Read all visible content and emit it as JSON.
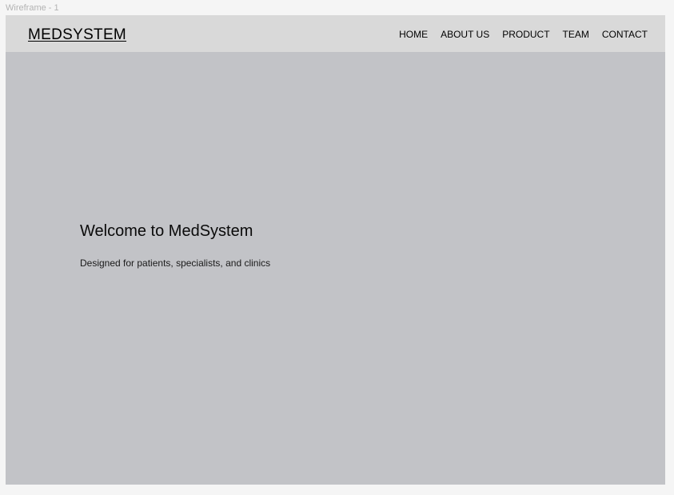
{
  "canvas": {
    "frame_label": "Wireframe - 1"
  },
  "header": {
    "logo": "MEDSYSTEM",
    "nav": [
      {
        "label": "HOME"
      },
      {
        "label": "ABOUT US"
      },
      {
        "label": "PRODUCT"
      },
      {
        "label": "TEAM"
      },
      {
        "label": "CONTACT"
      }
    ]
  },
  "hero": {
    "title": "Welcome to MedSystem",
    "subtitle": "Designed for patients, specialists, and clinics"
  },
  "colors": {
    "canvas_background": "#f5f5f5",
    "hero_background": "#c2c3c7",
    "navbar_background": "#d9d9d9",
    "text": "#000000"
  }
}
